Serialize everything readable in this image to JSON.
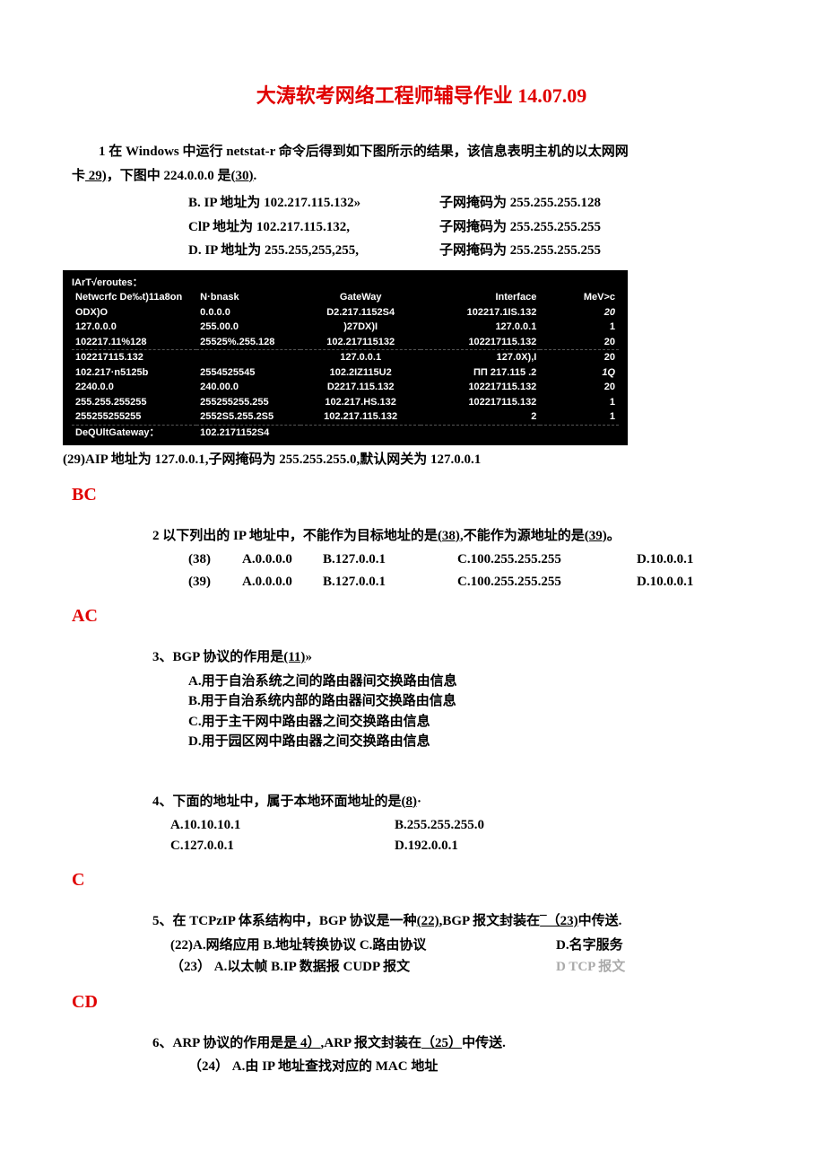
{
  "title": "大涛软考网络工程师辅导作业 14.07.09",
  "q1": {
    "line1a": "1 在 Windows 中运行 netstat-r 命令后得到如下图所示的结果，该信息表明主机的以太网网",
    "line1b_prefix": "卡",
    "line1b_u1": "  29)",
    "line1b_mid": "，下图中 224.0.0.0 是",
    "line1b_u2": "(30)",
    "line1b_suffix": ".",
    "opts": [
      {
        "a": "B. IP 地址为 102.217.115.132»",
        "b": "子网掩码为 255.255.255.128"
      },
      {
        "a": "ClP 地址为 102.217.115.132,",
        "b": "子网掩码为 255.255.255.255"
      },
      {
        "a": "D. IP 地址为 255.255,255,255,",
        "b": "子网掩码为 255.255.255.255"
      }
    ],
    "table": {
      "l1": "IArT√eroutes：",
      "hdr": [
        "Netwcrfc De‰t)11a8on",
        "N·bnask",
        "GateWay",
        "Interface",
        "MeV>c"
      ],
      "rows": [
        [
          "ODX)O",
          "0.0.0.0",
          "D2.217.1152S4",
          "102217.1IS.132",
          "20"
        ],
        [
          "127.0.0.0",
          "255.00.0",
          ")27DX)I",
          "127.0.0.1",
          "1"
        ],
        [
          "102217.11%128",
          "25525%.255.128",
          "102.217115132",
          "102217115.132",
          "20"
        ],
        [
          "102217115.132",
          "",
          "127.0.0.1",
          "127.0X),I",
          "20"
        ],
        [
          "102.217·n5125b",
          "2554525545",
          "102.2IZ115U2",
          "ΠΠ 217.115 .2",
          "1Q"
        ],
        [
          "2240.0.0",
          "240.00.0",
          "D2217.115.132",
          "102217115.132",
          "20"
        ],
        [
          "255.255.255255",
          "255255255.255",
          "102.217.HS.132",
          "102217115.132",
          "1"
        ],
        [
          "255255255255",
          "2552S5.255.2S5",
          "102.217.115.132",
          "2",
          "1"
        ]
      ],
      "footer": [
        "DeQUltGateway：",
        "102.2171152S4"
      ]
    },
    "post": "(29)AIP 地址为 127.0.0.1,子网掩码为 255.255.255.0,默认网关为 127.0.0.1",
    "answer": "BC"
  },
  "q2": {
    "stem_a": "2 以下列出的 IP 地址中，不能作为目标地址的是",
    "stem_u1": "(38)",
    "stem_mid": ",不能作为源地址的是",
    "stem_u2": "(39)",
    "stem_suf": "。",
    "rows": [
      [
        "(38)",
        "A.0.0.0.0",
        "B.127.0.0.1",
        "C.100.255.255.255",
        "D.10.0.0.1"
      ],
      [
        "(39)",
        "A.0.0.0.0",
        "B.127.0.0.1",
        "C.100.255.255.255",
        "D.10.0.0.1"
      ]
    ],
    "answer": "AC"
  },
  "q3": {
    "stem_a": "3、BGP 协议的作用是",
    "stem_u": "(11)",
    "stem_suf": "»",
    "opts": [
      "A.用于自治系统之间的路由器间交换路由信息",
      "B.用于自治系统内部的路由器间交换路由信息",
      "C.用于主干网中路由器之间交换路由信息",
      "D.用于园区网中路由器之间交换路由信息"
    ]
  },
  "q4": {
    "stem_a": "4、下面的地址中，属于本地环面地址的是",
    "stem_u": "(8)",
    "stem_suf": "·",
    "rows": [
      [
        "A.10.10.10.1",
        "B.255.255.255.0"
      ],
      [
        "C.127.0.0.1",
        "D.192.0.0.1"
      ]
    ],
    "answer": "C"
  },
  "q5": {
    "stem_a": "5、在 TCPzIP 体系结构中，BGP 协议是一种",
    "stem_u1": "(22)",
    "stem_mid": ",BGP 报文封装在",
    "stem_u2": "¯（23)",
    "stem_suf": "中传送.",
    "row1a": "(22)A.网络应用 B.地址转换协议 C.路由协议",
    "row1b": "D.名字服务",
    "row2a": "（23）     A.以太帧 B.IP 数据报 CUDP 报文",
    "row2b": "D TCP 报文",
    "answer": "CD"
  },
  "q6": {
    "stem_a": "6、ARP 协议的作用是",
    "stem_u1": "是 4）",
    "stem_mid": ",ARP 报文封装在",
    "stem_u2": "（25）",
    "stem_suf": "中传送.",
    "line2": "（24）   A.由 IP 地址查找对应的 MAC 地址"
  }
}
